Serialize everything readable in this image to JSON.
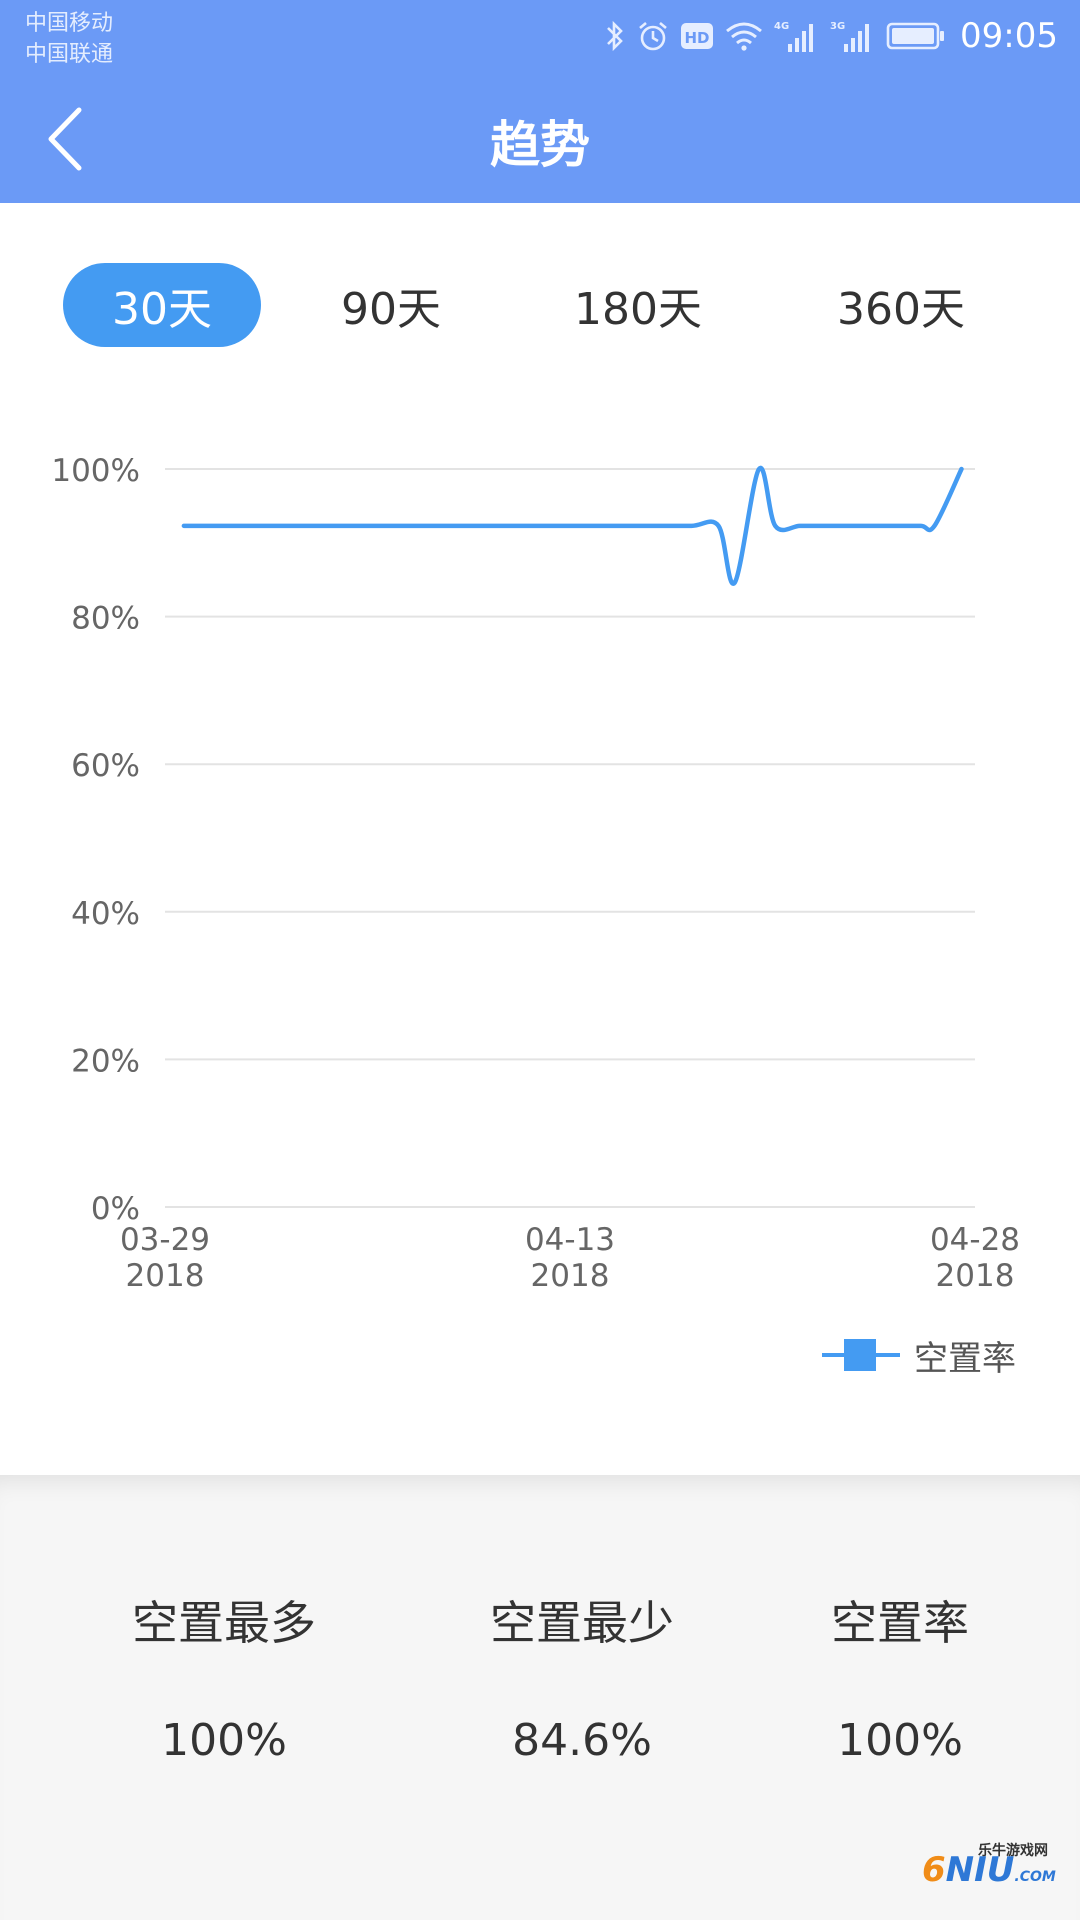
{
  "status_bar": {
    "carrier_1": "中国移动",
    "carrier_2": "中国联通",
    "network_4g": "4G",
    "network_3g": "3G",
    "hd_badge": "HD",
    "time": "09:05"
  },
  "header": {
    "title": "趋势",
    "background_color": "#6b9af6"
  },
  "range_tabs": [
    {
      "label": "30天",
      "active": true
    },
    {
      "label": "90天",
      "active": false
    },
    {
      "label": "180天",
      "active": false
    },
    {
      "label": "360天",
      "active": false
    }
  ],
  "chart_data": {
    "type": "line",
    "title": "",
    "xlabel": "",
    "ylabel": "",
    "ylim": [
      0,
      100
    ],
    "y_ticks": [
      "0%",
      "20%",
      "40%",
      "60%",
      "80%",
      "100%"
    ],
    "y_tick_values": [
      0,
      20,
      40,
      60,
      80,
      100
    ],
    "x_tick_labels": [
      {
        "date": "03-29",
        "year": "2018",
        "day_index": 0
      },
      {
        "date": "04-13",
        "year": "2018",
        "day_index": 15
      },
      {
        "date": "04-28",
        "year": "2018",
        "day_index": 30
      }
    ],
    "x_range": [
      0,
      30
    ],
    "grid": true,
    "legend_position": "bottom-right",
    "color": "#449bf2",
    "series": [
      {
        "name": "空置率",
        "x": [
          0.7,
          2,
          4,
          6,
          8,
          10,
          12,
          14,
          16,
          18,
          19.5,
          20.5,
          21.1,
          22,
          22.6,
          23.5,
          24.2,
          25.5,
          27,
          28,
          28.5,
          29.5
        ],
        "values": [
          92.3,
          92.3,
          92.3,
          92.3,
          92.3,
          92.3,
          92.3,
          92.3,
          92.3,
          92.3,
          92.3,
          92.3,
          84.6,
          100,
          92.3,
          92.3,
          92.3,
          92.3,
          92.3,
          92.3,
          92.3,
          100
        ]
      }
    ]
  },
  "stats": [
    {
      "label": "空置最多",
      "value": "100%"
    },
    {
      "label": "空置最少",
      "value": "84.6%"
    },
    {
      "label": "空置率",
      "value": "100%"
    }
  ],
  "watermark": {
    "site_name": "乐牛游戏网",
    "brand_six": "6",
    "brand_text": "NIU",
    "brand_suffix": ".COM"
  }
}
